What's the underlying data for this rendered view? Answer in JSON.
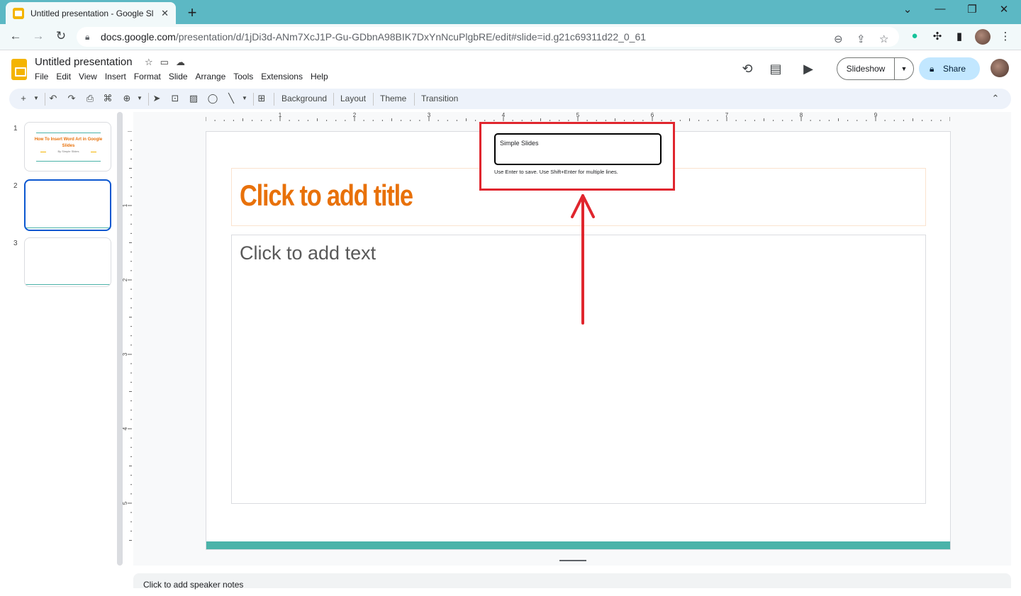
{
  "browser": {
    "tab_title": "Untitled presentation - Google Sl",
    "url_host": "docs.google.com",
    "url_path": "/presentation/d/1jDi3d-ANm7XcJ1P-Gu-GDbnA98BIK7DxYnNcuPlgbRE/edit#slide=id.g21c69311d22_0_61"
  },
  "app": {
    "doc_title": "Untitled presentation",
    "menu": [
      "File",
      "Edit",
      "View",
      "Insert",
      "Format",
      "Slide",
      "Arrange",
      "Tools",
      "Extensions",
      "Help"
    ],
    "slideshow_label": "Slideshow",
    "share_label": "Share"
  },
  "toolbar": {
    "background": "Background",
    "layout": "Layout",
    "theme": "Theme",
    "transition": "Transition"
  },
  "filmstrip": {
    "numbers": [
      "1",
      "2",
      "3"
    ],
    "slide1_title": "How To Insert Word Art in Google Slides",
    "slide1_sub": "By Simple Slides"
  },
  "rulers": {
    "h": [
      "1",
      "2",
      "3",
      "4",
      "5",
      "6",
      "7",
      "8",
      "9"
    ],
    "v": [
      "1",
      "2",
      "3",
      "4",
      "5"
    ]
  },
  "slide": {
    "title_placeholder": "Click to add title",
    "body_placeholder": "Click to add text"
  },
  "popup": {
    "value": "Simple Slides",
    "hint": "Use Enter to save. Use Shift+Enter for multiple lines."
  },
  "notes": {
    "placeholder": "Click to add speaker notes"
  },
  "colors": {
    "accent_teal": "#4bb3a9",
    "title_orange": "#e8710a",
    "annotation_red": "#e0262e",
    "tab_strip": "#5cb8c4"
  }
}
